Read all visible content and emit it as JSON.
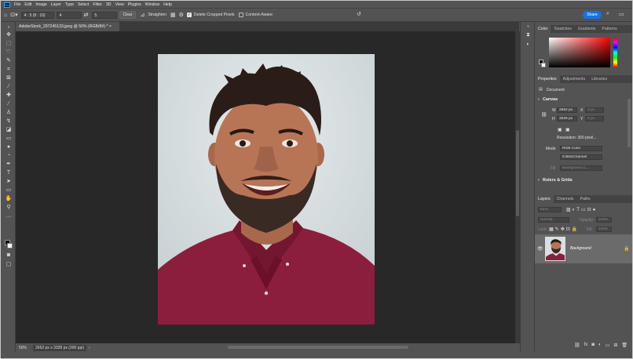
{
  "app": {
    "logo": "Ps"
  },
  "menu": [
    "File",
    "Edit",
    "Image",
    "Layer",
    "Type",
    "Select",
    "Filter",
    "3D",
    "View",
    "Plugins",
    "Window",
    "Help"
  ],
  "options": {
    "ratio_value": "4 : 5 (8 : 10)",
    "width_value": "4",
    "height_value": "5",
    "clear_label": "Clear",
    "straighten_label": "Straighten",
    "delete_cropped_label": "Delete Cropped Pixels",
    "content_aware_label": "Content-Aware",
    "share_label": "Share"
  },
  "document": {
    "tab_label": "AdobeStock_297245133.jpeg @ 50% (RGB/8#) * ×"
  },
  "status": {
    "zoom": "50%",
    "info": "2662 px x 3328 px (300 ppi)"
  },
  "color_panel": {
    "tabs": [
      "Color",
      "Swatches",
      "Gradients",
      "Patterns"
    ]
  },
  "properties_panel": {
    "tabs": [
      "Properties",
      "Adjustments",
      "Libraries"
    ],
    "doc_label": "Document",
    "canvas_heading": "Canvas",
    "w_label": "W",
    "w_value": "2662 px",
    "h_label": "H",
    "h_value": "3328 px",
    "x_label": "X",
    "x_value": "0 px",
    "y_label": "Y",
    "y_value": "0 px",
    "resolution": "Resolution: 300 pixel...",
    "mode_label": "Mode",
    "mode_value": "RGB Color",
    "bits_value": "8 Bits/Channel",
    "fill_label": "Fill",
    "fill_value": "Background C...",
    "rulers_heading": "Rulers & Grids"
  },
  "layers_panel": {
    "tabs": [
      "Layers",
      "Channels",
      "Paths"
    ],
    "kind_placeholder": "Kind",
    "blend_mode": "Normal",
    "opacity_label": "Opacity:",
    "opacity_value": "100%",
    "lock_label": "Lock:",
    "fill_label": "Fill:",
    "fill_value": "100%",
    "layer_name": "Background"
  },
  "icons": [
    "move-icon",
    "marquee-icon",
    "lasso-icon",
    "quick-select-icon",
    "crop-icon",
    "frame-icon",
    "eyedropper-icon",
    "healing-icon",
    "brush-icon",
    "clone-stamp-icon",
    "history-brush-icon",
    "eraser-icon",
    "gradient-icon",
    "blur-icon",
    "dodge-icon",
    "pen-icon",
    "type-icon",
    "path-select-icon",
    "rectangle-icon",
    "hand-icon",
    "zoom-icon",
    "more-tools-icon"
  ]
}
